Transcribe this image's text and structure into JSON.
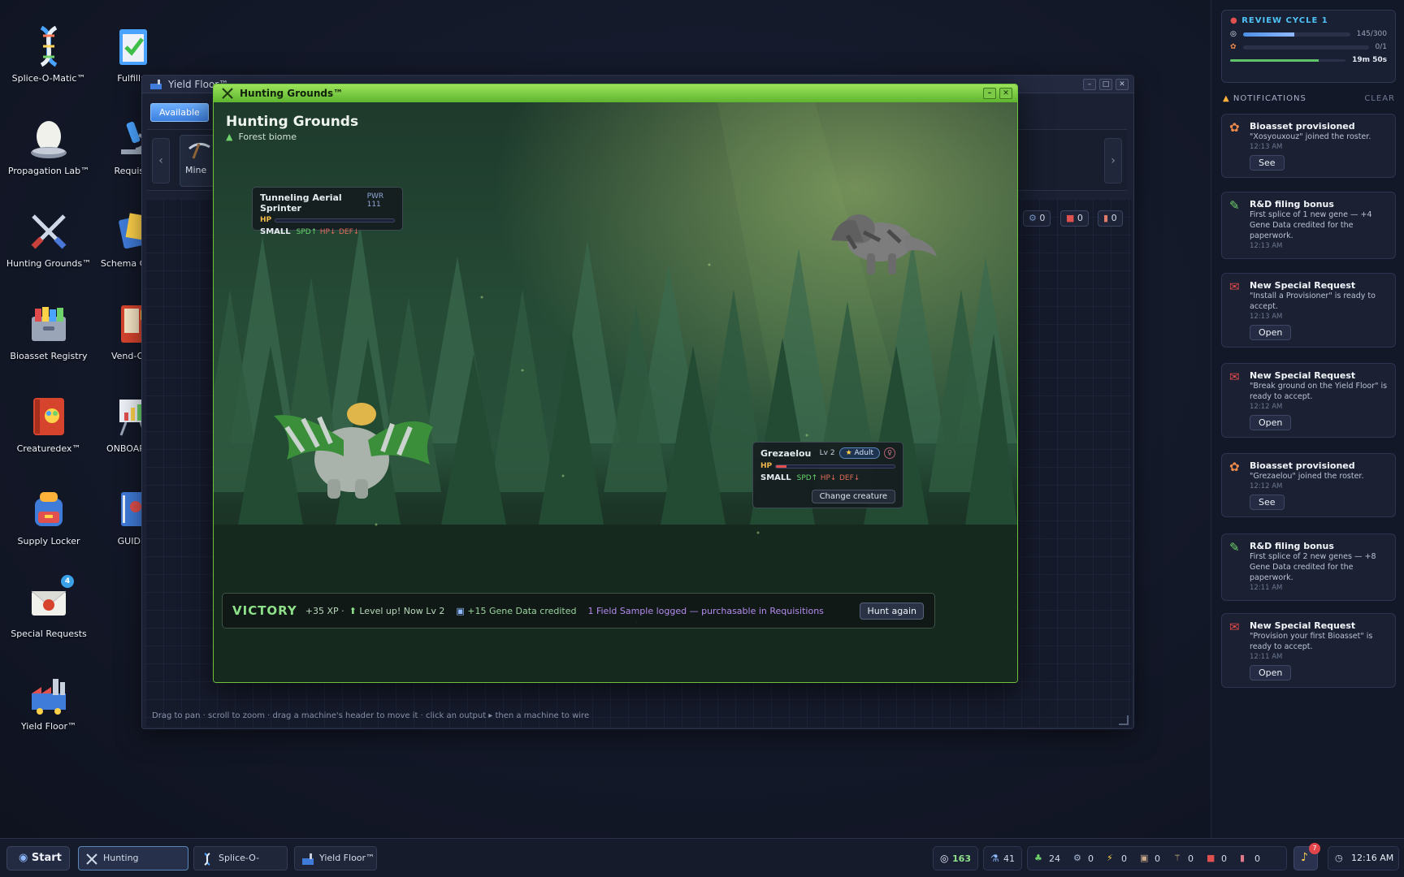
{
  "desktop": {
    "icons": [
      {
        "label": "Splice-O-Matic™"
      },
      {
        "label": "Fulfillm"
      },
      {
        "label": "Propagation Lab™"
      },
      {
        "label": "Requisiti"
      },
      {
        "label": "Hunting Grounds™"
      },
      {
        "label": "Schema Cente"
      },
      {
        "label": "Bioasset Registry"
      },
      {
        "label": "Vend-O-M"
      },
      {
        "label": "Creaturedex™"
      },
      {
        "label": "ONBOARI pt"
      },
      {
        "label": "Supply Locker"
      },
      {
        "label": "GUIDE."
      },
      {
        "label": "Special Requests",
        "badge": "4"
      },
      {
        "label": "Yield Floor™"
      }
    ]
  },
  "yield_floor": {
    "title": "Yield Floor™",
    "tab": "Available",
    "machine": "Mine",
    "hint": "Drag to pan · scroll to zoom · drag a machine's header to move it · click an output ▸ then a machine to wire",
    "chips": [
      "0",
      "0",
      "0"
    ]
  },
  "hunting": {
    "window_title": "Hunting Grounds™",
    "heading": "Hunting Grounds",
    "biome": "Forest biome",
    "enemy": {
      "name": "Tunneling Aerial Sprinter",
      "power": "PWR 111",
      "hp_label": "HP",
      "hp_fraction": 0.0,
      "size": "SMALL",
      "stats": [
        "SPD↑",
        "HP↓",
        "DEF↓"
      ]
    },
    "player": {
      "name": "Grezaelou",
      "level": "Lv 2",
      "stage": "Adult",
      "hp_label": "HP",
      "hp_fraction": 0.09,
      "size": "SMALL",
      "stats": [
        "SPD↑",
        "HP↓",
        "DEF↓"
      ],
      "change_label": "Change creature"
    },
    "result": {
      "title": "VICTORY",
      "xp": "+35 XP ·",
      "levelup": "Level up! Now Lv 2",
      "gene": "+15 Gene Data credited",
      "sample": "1 Field Sample logged — purchasable in Requisitions",
      "button": "Hunt again"
    }
  },
  "review": {
    "title": "REVIEW CYCLE 1",
    "xp_value": "145/300",
    "xp_fraction": 0.483,
    "creatures_value": "0/1",
    "creatures_fraction": 0.0,
    "timer": "19m 50s",
    "timer_fraction": 0.77
  },
  "notifications": {
    "header": "NOTIFICATIONS",
    "clear": "CLEAR",
    "items": [
      {
        "title": "Bioasset provisioned",
        "body": "\"Xosyouxouz\" joined the roster.",
        "time": "12:13 AM",
        "action": "See",
        "icon": "paw-icon"
      },
      {
        "title": "R&D filing bonus",
        "body": "First splice of 1 new gene — +4 Gene Data credited for the paperwork.",
        "time": "12:13 AM",
        "action": "",
        "icon": "pencil-icon"
      },
      {
        "title": "New Special Request",
        "body": "\"Install a Provisioner\" is ready to accept.",
        "time": "12:13 AM",
        "action": "Open",
        "icon": "envelope-icon"
      },
      {
        "title": "New Special Request",
        "body": "\"Break ground on the Yield Floor\" is ready to accept.",
        "time": "12:12 AM",
        "action": "Open",
        "icon": "envelope-icon"
      },
      {
        "title": "Bioasset provisioned",
        "body": "\"Grezaelou\" joined the roster.",
        "time": "12:12 AM",
        "action": "See",
        "icon": "paw-icon"
      },
      {
        "title": "R&D filing bonus",
        "body": "First splice of 2 new genes — +8 Gene Data credited for the paperwork.",
        "time": "12:11 AM",
        "action": "",
        "icon": "pencil-icon"
      },
      {
        "title": "New Special Request",
        "body": "\"Provision your first Bioasset\" is ready to accept.",
        "time": "12:11 AM",
        "action": "Open",
        "icon": "envelope-icon"
      }
    ]
  },
  "taskbar": {
    "start": "Start",
    "apps": [
      "Hunting Grounds™",
      "Splice-O-Matic™",
      "Yield Floor™"
    ],
    "coins": "163",
    "flasks": "41",
    "resources": [
      "24",
      "0",
      "0",
      "0",
      "0",
      "0",
      "0"
    ],
    "bell_badge": "7",
    "clock": "12:16 AM"
  },
  "colors": {
    "accent_green": "#8fe08a",
    "titlebar_green": "#6fc23a",
    "hp_red": "#e0504e",
    "review_blue": "#4fc3f7"
  }
}
